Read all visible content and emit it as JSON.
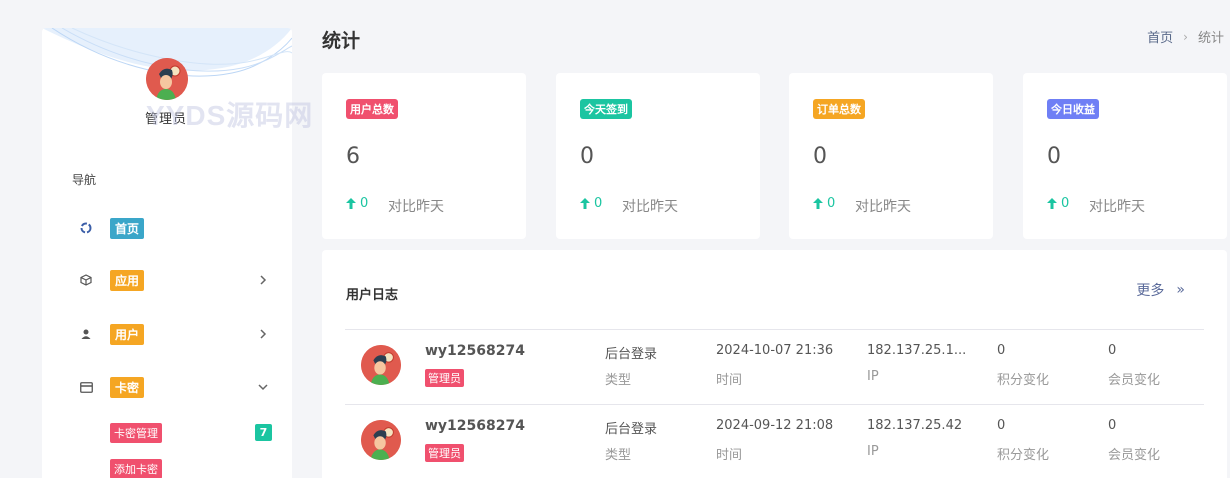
{
  "sidebar": {
    "admin_name": "管理员",
    "watermark": "YYDS源码网",
    "nav_title": "导航",
    "items": [
      {
        "label": "首页",
        "color": "#3aa6c9",
        "icon": "dashboard-icon"
      },
      {
        "label": "应用",
        "color": "#f5a623",
        "icon": "cube-icon"
      },
      {
        "label": "用户",
        "color": "#f5a623",
        "icon": "user-icon"
      },
      {
        "label": "卡密",
        "color": "#f5a623",
        "icon": "card-icon"
      }
    ],
    "sub_items": [
      {
        "label": "卡密管理",
        "count": "7"
      },
      {
        "label": "添加卡密"
      }
    ]
  },
  "header": {
    "title": "统计",
    "breadcrumb": [
      "首页",
      "统计"
    ]
  },
  "stats": [
    {
      "badge": "用户总数",
      "color": "#f0506e",
      "value": "6",
      "change": "0",
      "change_label": "对比昨天"
    },
    {
      "badge": "今天签到",
      "color": "#1bc5a1",
      "value": "0",
      "change": "0",
      "change_label": "对比昨天"
    },
    {
      "badge": "订单总数",
      "color": "#f5a623",
      "value": "0",
      "change": "0",
      "change_label": "对比昨天"
    },
    {
      "badge": "今日收益",
      "color": "#6f7ff5",
      "value": "0",
      "change": "0",
      "change_label": "对比昨天"
    }
  ],
  "log": {
    "title": "用户日志",
    "more": "更多",
    "rows": [
      {
        "user": "wy12568274",
        "role": "管理员",
        "type": "后台登录",
        "type_label": "类型",
        "time": "2024-10-07 21:36",
        "time_label": "时间",
        "ip": "182.137.25.1...",
        "ip_label": "IP",
        "points": "0",
        "points_label": "积分变化",
        "member": "0",
        "member_label": "会员变化"
      },
      {
        "user": "wy12568274",
        "role": "管理员",
        "type": "后台登录",
        "type_label": "类型",
        "time": "2024-09-12 21:08",
        "time_label": "时间",
        "ip": "182.137.25.42",
        "ip_label": "IP",
        "points": "0",
        "points_label": "积分变化",
        "member": "0",
        "member_label": "会员变化"
      }
    ]
  }
}
